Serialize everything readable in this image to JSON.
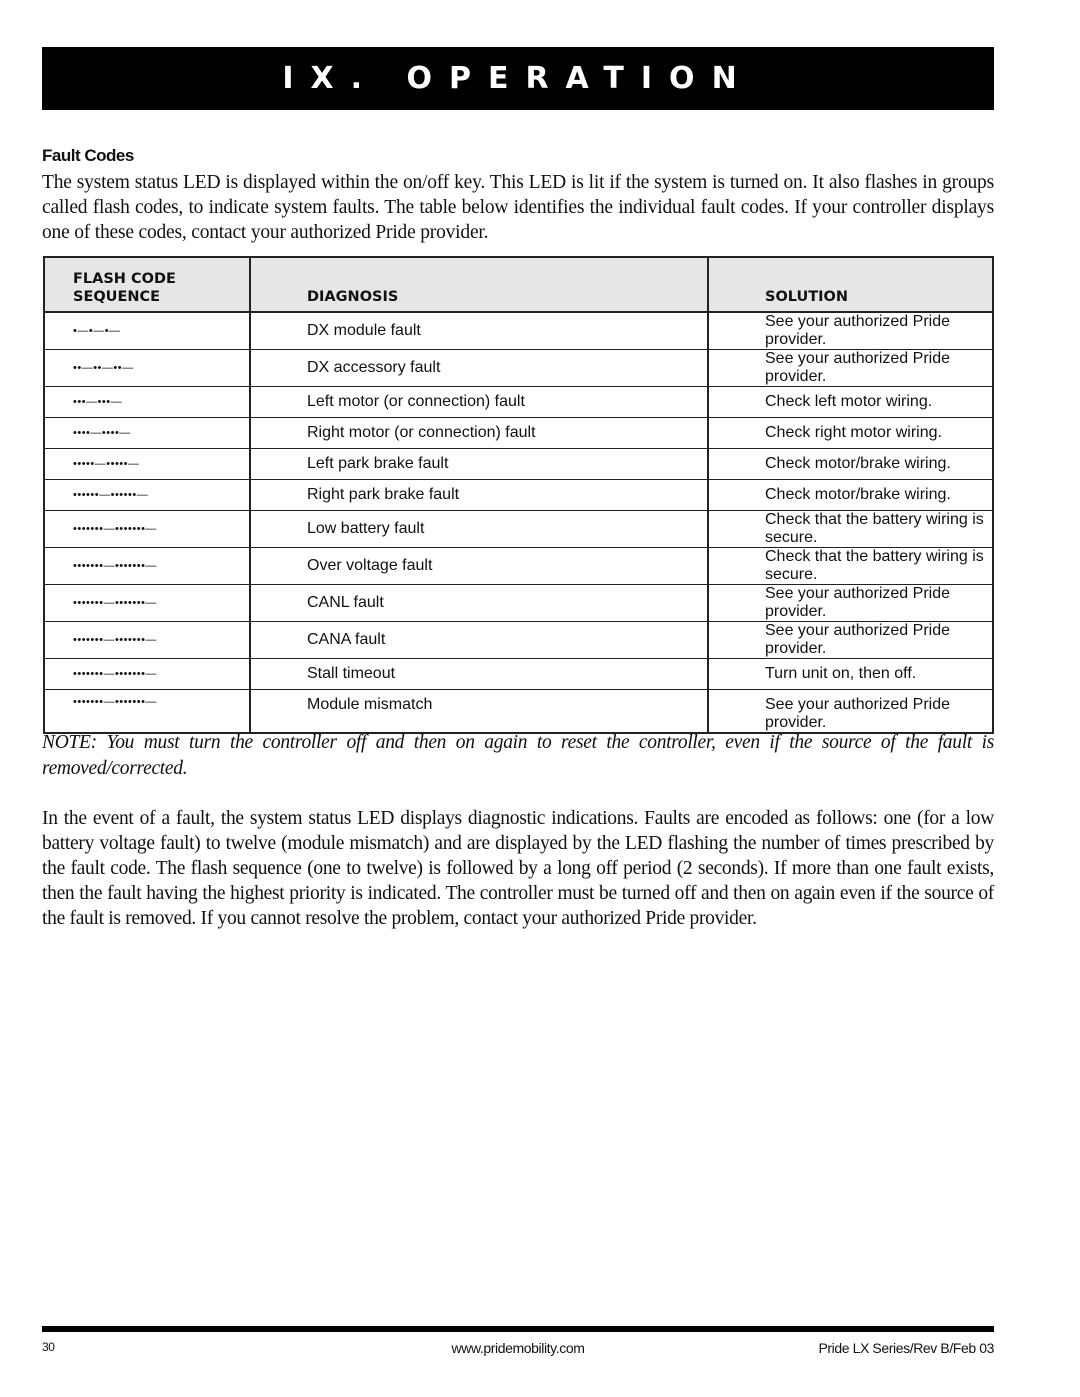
{
  "banner": {
    "title": "IX. OPERATION"
  },
  "section": {
    "title": "Fault Codes",
    "intro": "The system status LED is displayed within the on/off key. This LED is lit if the system is turned on. It also flashes in groups called flash codes, to indicate system faults. The table below identifies the individual fault codes. If your controller displays one of these codes, contact your authorized Pride provider."
  },
  "table": {
    "headers": {
      "sequence_line1": "FLASH CODE",
      "sequence_line2": "SEQUENCE",
      "diagnosis": "DIAGNOSIS",
      "solution": "SOLUTION"
    },
    "rows": [
      {
        "sequence": "•—•—•—",
        "diagnosis": "DX module fault",
        "solution": "See your authorized Pride provider."
      },
      {
        "sequence": "••—••—••—",
        "diagnosis": "DX accessory fault",
        "solution": "See your authorized Pride provider."
      },
      {
        "sequence": "•••—•••—",
        "diagnosis": "Left motor (or connection) fault",
        "solution": "Check left motor wiring."
      },
      {
        "sequence": "••••—••••—",
        "diagnosis": "Right motor (or connection) fault",
        "solution": "Check right motor wiring."
      },
      {
        "sequence": "•••••—•••••—",
        "diagnosis": "Left park brake fault",
        "solution": "Check motor/brake wiring."
      },
      {
        "sequence": "••••••—••••••—",
        "diagnosis": "Right park brake fault",
        "solution": "Check motor/brake wiring."
      },
      {
        "sequence": "•••••••—•••••••—",
        "diagnosis": "Low battery fault",
        "solution": "Check that the battery wiring is secure."
      },
      {
        "sequence": "•••••••—•••••••—",
        "diagnosis": "Over voltage fault",
        "solution": "Check that the battery wiring is secure."
      },
      {
        "sequence": "•••••••—•••••••—",
        "diagnosis": "CANL fault",
        "solution": "See your authorized Pride provider."
      },
      {
        "sequence": "•••••••—•••••••—",
        "diagnosis": "CANA fault",
        "solution": "See your authorized Pride provider."
      },
      {
        "sequence": "•••••••—•••••••—",
        "diagnosis": "Stall timeout",
        "solution": "Turn unit on, then off."
      },
      {
        "sequence": "•••••••—•••••••—",
        "diagnosis": "Module mismatch",
        "solution": "See your authorized Pride provider."
      }
    ]
  },
  "note": "NOTE: You must turn the controller off and then on again to reset the controller, even if the source of the fault is removed/corrected.",
  "body": "In the event of a fault, the system status LED displays diagnostic indications. Faults are encoded as follows: one (for a low battery voltage fault) to twelve (module mismatch) and are displayed by the LED flashing the number of times prescribed by the fault code. The flash sequence (one to twelve) is followed by a long off period (2 seconds). If more than one fault exists, then the fault having the highest priority is indicated. The controller must be turned off and then on again even if the source of the fault is removed. If you cannot resolve the problem, contact your authorized Pride provider.",
  "footer": {
    "page_number": "30",
    "url": "www.pridemobility.com",
    "revision": "Pride LX Series/Rev B/Feb 03"
  }
}
